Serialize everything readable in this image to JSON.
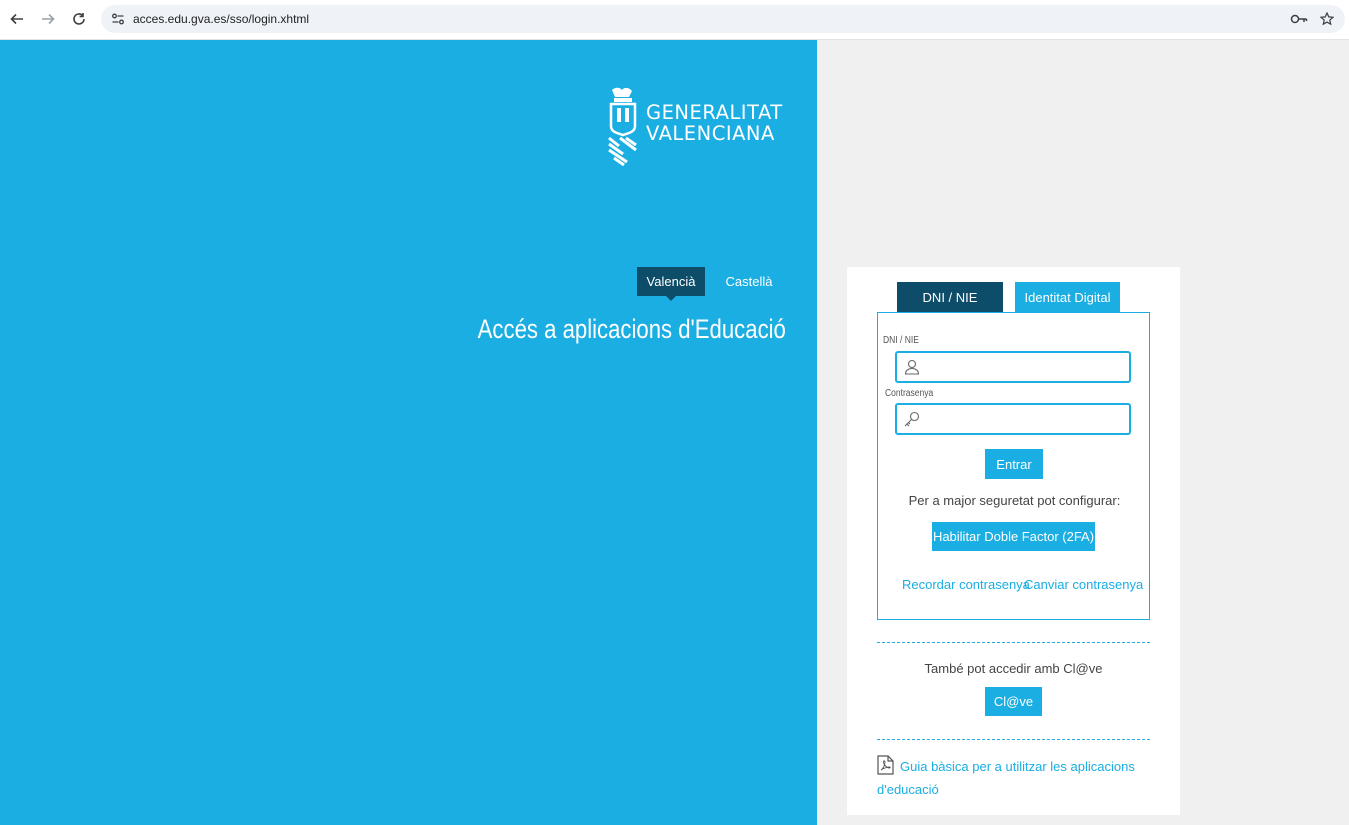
{
  "browser": {
    "url": "acces.edu.gva.es/sso/login.xhtml"
  },
  "brand": {
    "line1": "GENERALITAT",
    "line2": "VALENCIANA"
  },
  "languages": {
    "valencia": "Valencià",
    "castella": "Castellà"
  },
  "page": {
    "title": "Accés a aplicacions d'Educació"
  },
  "login": {
    "tabs": [
      "DNI / NIE",
      "Identitat Digital"
    ],
    "dni_label": "DNI / NIE",
    "dni_value": "",
    "password_label": "Contrasenya",
    "password_value": "",
    "enter_button": "Entrar",
    "security_text": "Per a major seguretat pot configurar:",
    "two_factor_button": "Habilitar Doble Factor (2FA)",
    "remember_link": "Recordar contrasenya",
    "change_link": "Canviar contrasenya",
    "also_text": "També pot accedir amb Cl@ve",
    "clave_button": "Cl@ve",
    "guide_link": "Guia bàsica per a utilitzar les aplicacions d'educació"
  },
  "colors": {
    "primary": "#1aaee2",
    "dark": "#0d4d69"
  }
}
